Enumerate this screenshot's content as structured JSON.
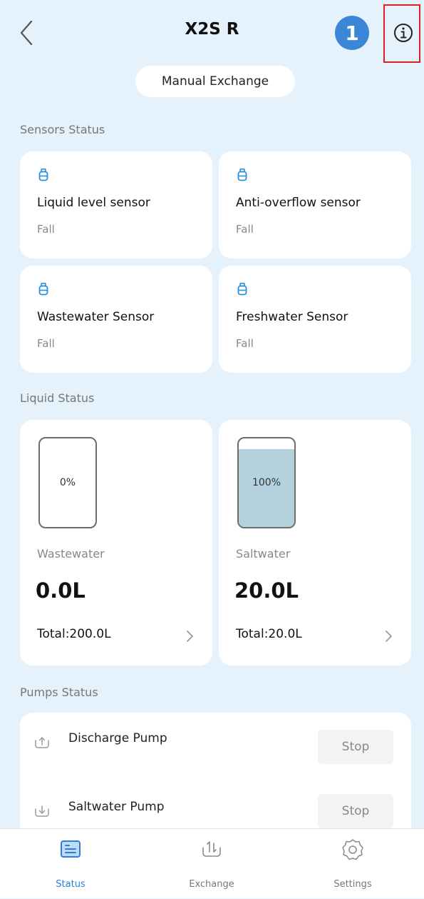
{
  "header": {
    "title": "X2S R",
    "step_badge": "1"
  },
  "manual_exchange_label": "Manual Exchange",
  "sensors": {
    "section_title": "Sensors Status",
    "items": [
      {
        "name": "Liquid level sensor",
        "state": "Fall",
        "icon": "sensor-icon"
      },
      {
        "name": "Anti-overflow sensor",
        "state": "Fall",
        "icon": "sensor-icon"
      },
      {
        "name": "Wastewater Sensor",
        "state": "Fall",
        "icon": "sensor-icon"
      },
      {
        "name": "Freshwater Sensor",
        "state": "Fall",
        "icon": "sensor-icon"
      }
    ]
  },
  "liquid": {
    "section_title": "Liquid Status",
    "items": [
      {
        "percent_label": "0%",
        "fill_fraction": 0,
        "name": "Wastewater",
        "amount": "0.0L",
        "total": "Total:200.0L"
      },
      {
        "percent_label": "100%",
        "fill_fraction": 1,
        "name": "Saltwater",
        "amount": "20.0L",
        "total": "Total:20.0L"
      }
    ]
  },
  "pumps": {
    "section_title": "Pumps Status",
    "items": [
      {
        "name": "Discharge Pump",
        "button": "Stop",
        "icon": "pump-up-icon"
      },
      {
        "name": "Saltwater Pump",
        "button": "Stop",
        "icon": "pump-down-icon"
      }
    ]
  },
  "tabs": [
    {
      "label": "Status",
      "active": true,
      "icon": "status-icon"
    },
    {
      "label": "Exchange",
      "active": false,
      "icon": "exchange-icon"
    },
    {
      "label": "Settings",
      "active": false,
      "icon": "settings-icon"
    }
  ],
  "colors": {
    "background": "#e5f2fb",
    "accent": "#2b7fd9",
    "badge": "#3b86d6",
    "highlight": "#e02020",
    "tank_fill": "#b3d2de"
  }
}
